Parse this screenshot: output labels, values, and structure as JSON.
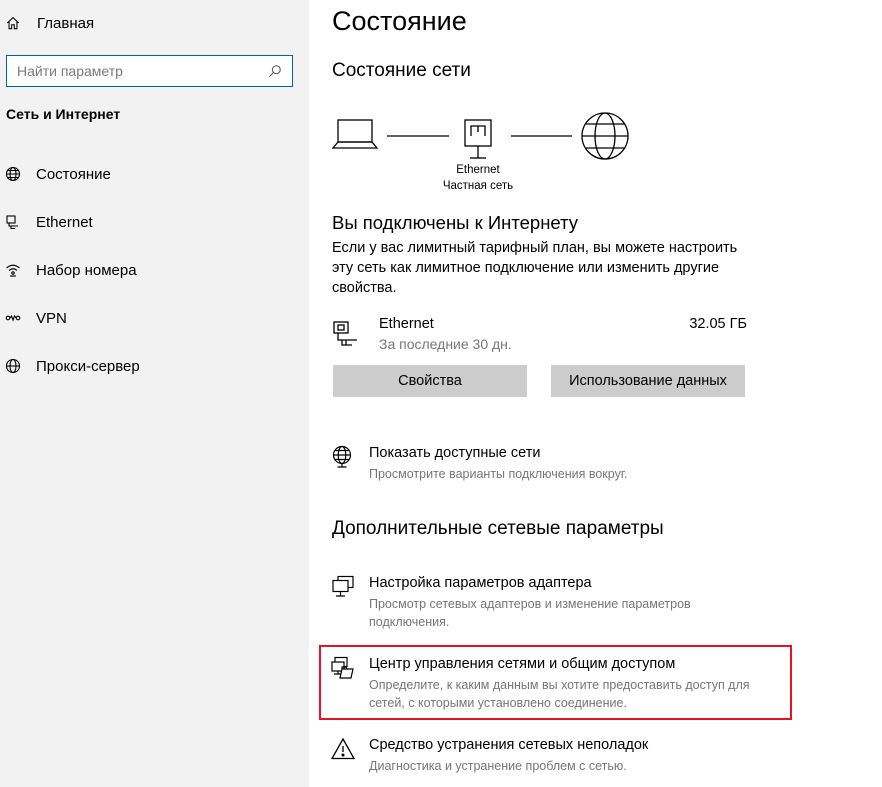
{
  "sidebar": {
    "home_label": "Главная",
    "search_placeholder": "Найти параметр",
    "section_title": "Сеть и Интернет",
    "items": [
      {
        "label": "Состояние",
        "icon": "globe-status-icon"
      },
      {
        "label": "Ethernet",
        "icon": "ethernet-icon"
      },
      {
        "label": "Набор номера",
        "icon": "dialup-icon"
      },
      {
        "label": "VPN",
        "icon": "vpn-icon"
      },
      {
        "label": "Прокси-сервер",
        "icon": "globe-icon"
      }
    ]
  },
  "main": {
    "title": "Состояние",
    "network_status_title": "Состояние сети",
    "diagram": {
      "adapter_name": "Ethernet",
      "network_type": "Частная сеть"
    },
    "connected_title": "Вы подключены к Интернету",
    "connected_desc": "Если у вас лимитный тарифный план, вы можете настроить эту сеть как лимитное подключение или изменить другие свойства.",
    "connection": {
      "name": "Ethernet",
      "period": "За последние 30 дн.",
      "usage": "32.05 ГБ"
    },
    "buttons": {
      "properties": "Свойства",
      "data_usage": "Использование данных"
    },
    "show_networks": {
      "title": "Показать доступные сети",
      "desc": "Просмотрите варианты подключения вокруг."
    },
    "advanced_title": "Дополнительные сетевые параметры",
    "adapter_settings": {
      "title": "Настройка параметров адаптера",
      "desc": "Просмотр сетевых адаптеров и изменение параметров подключения."
    },
    "sharing_center": {
      "title": "Центр управления сетями и общим доступом",
      "desc": "Определите, к каким данным вы хотите предоставить доступ для сетей, с которыми установлено соединение."
    },
    "troubleshooter": {
      "title": "Средство устранения сетевых неполадок",
      "desc": "Диагностика и устранение проблем с сетью."
    }
  },
  "colors": {
    "accent": "#0063b1",
    "highlight": "#e81123",
    "sidebar_bg": "#f2f2f2",
    "button_bg": "#cccccc",
    "secondary_text": "#767676"
  }
}
